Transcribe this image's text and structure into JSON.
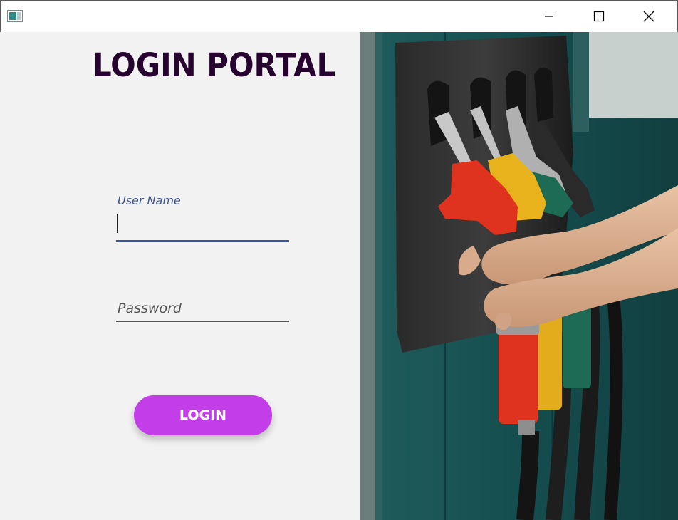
{
  "window": {
    "controls": {
      "minimize_icon": "minimize-icon",
      "maximize_icon": "maximize-icon",
      "close_icon": "close-icon"
    }
  },
  "login": {
    "title": "LOGIN PORTAL",
    "username": {
      "label": "User Name",
      "value": "",
      "focused": true
    },
    "password": {
      "placeholder": "Password",
      "value": ""
    },
    "submit_label": "LOGIN"
  },
  "colors": {
    "title": "#26042f",
    "accent_button": "#c33ee8",
    "focused_underline": "#3b58a8",
    "panel_background": "#f2f2f2"
  },
  "image": {
    "subject": "hands holding fuel pump nozzles",
    "nozzle_colors": [
      "#e0331f",
      "#e8b21d",
      "#1e6b55",
      "#222222"
    ]
  }
}
